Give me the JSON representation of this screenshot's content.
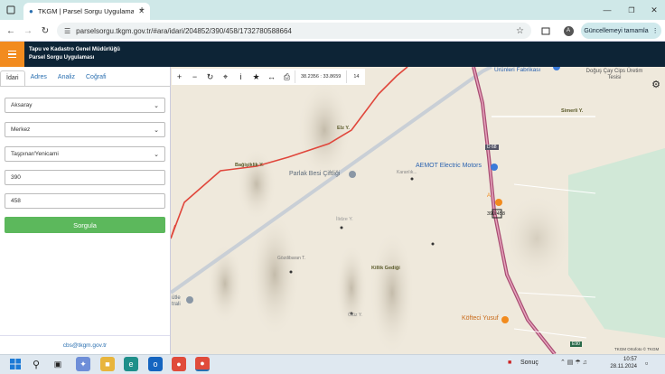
{
  "browser": {
    "tab_title": "TKGM | Parsel Sorgu Uygulaması",
    "url": "parselsorgu.tkgm.gov.tr/#ara/idari/204852/390/458/1732780588664",
    "update_label": "Güncellemeyi tamamla",
    "profile_initial": "A"
  },
  "app": {
    "title_line1": "Tapu ve Kadastro Genel Müdürlüğü",
    "title_line2": "Parsel Sorgu Uygulaması"
  },
  "panel": {
    "tabs": [
      "İdari",
      "Adres",
      "Analiz",
      "Coğrafi"
    ],
    "province": "Aksaray",
    "district": "Merkez",
    "neighborhood": "Taşpınar/Yenicami",
    "block": "390",
    "parcel": "458",
    "submit_label": "Sorgula",
    "footer_email": "cbs@tkgm.gov.tr"
  },
  "map": {
    "coordinates": "38.2356 : 33.8659",
    "zoom_level": "14",
    "labels": {
      "factory": "Ürünleri Fabrikası",
      "dogus": "Doğuş Çay Cips Üretim Tesisi",
      "simerli": "Simerli Y.",
      "elz": "Elz Y.",
      "bagisiklik": "Bağişiklik Y.",
      "parlak": "Parlak Besi Çiftliği",
      "aemot": "AEMOT Electric Motors",
      "karanlik": "Karanlık...",
      "d_label": "D 68",
      "e90a": "E90",
      "pin_label": "A",
      "parcel_label": "390/458",
      "ilidze": "İlidze Y.",
      "gozdibaran": "Gözdibaran T.",
      "killik": "Killik Gediği",
      "cotla": "Ötüz Y.",
      "dutle": "ütle trali",
      "kofteci": "Köfteci Yusuf",
      "e90b": "E90",
      "attribution": "TKGM Ortofoto © TKGM"
    }
  },
  "taskbar": {
    "weather": "Sonuç",
    "time": "10:57",
    "date": "28.11.2024"
  }
}
